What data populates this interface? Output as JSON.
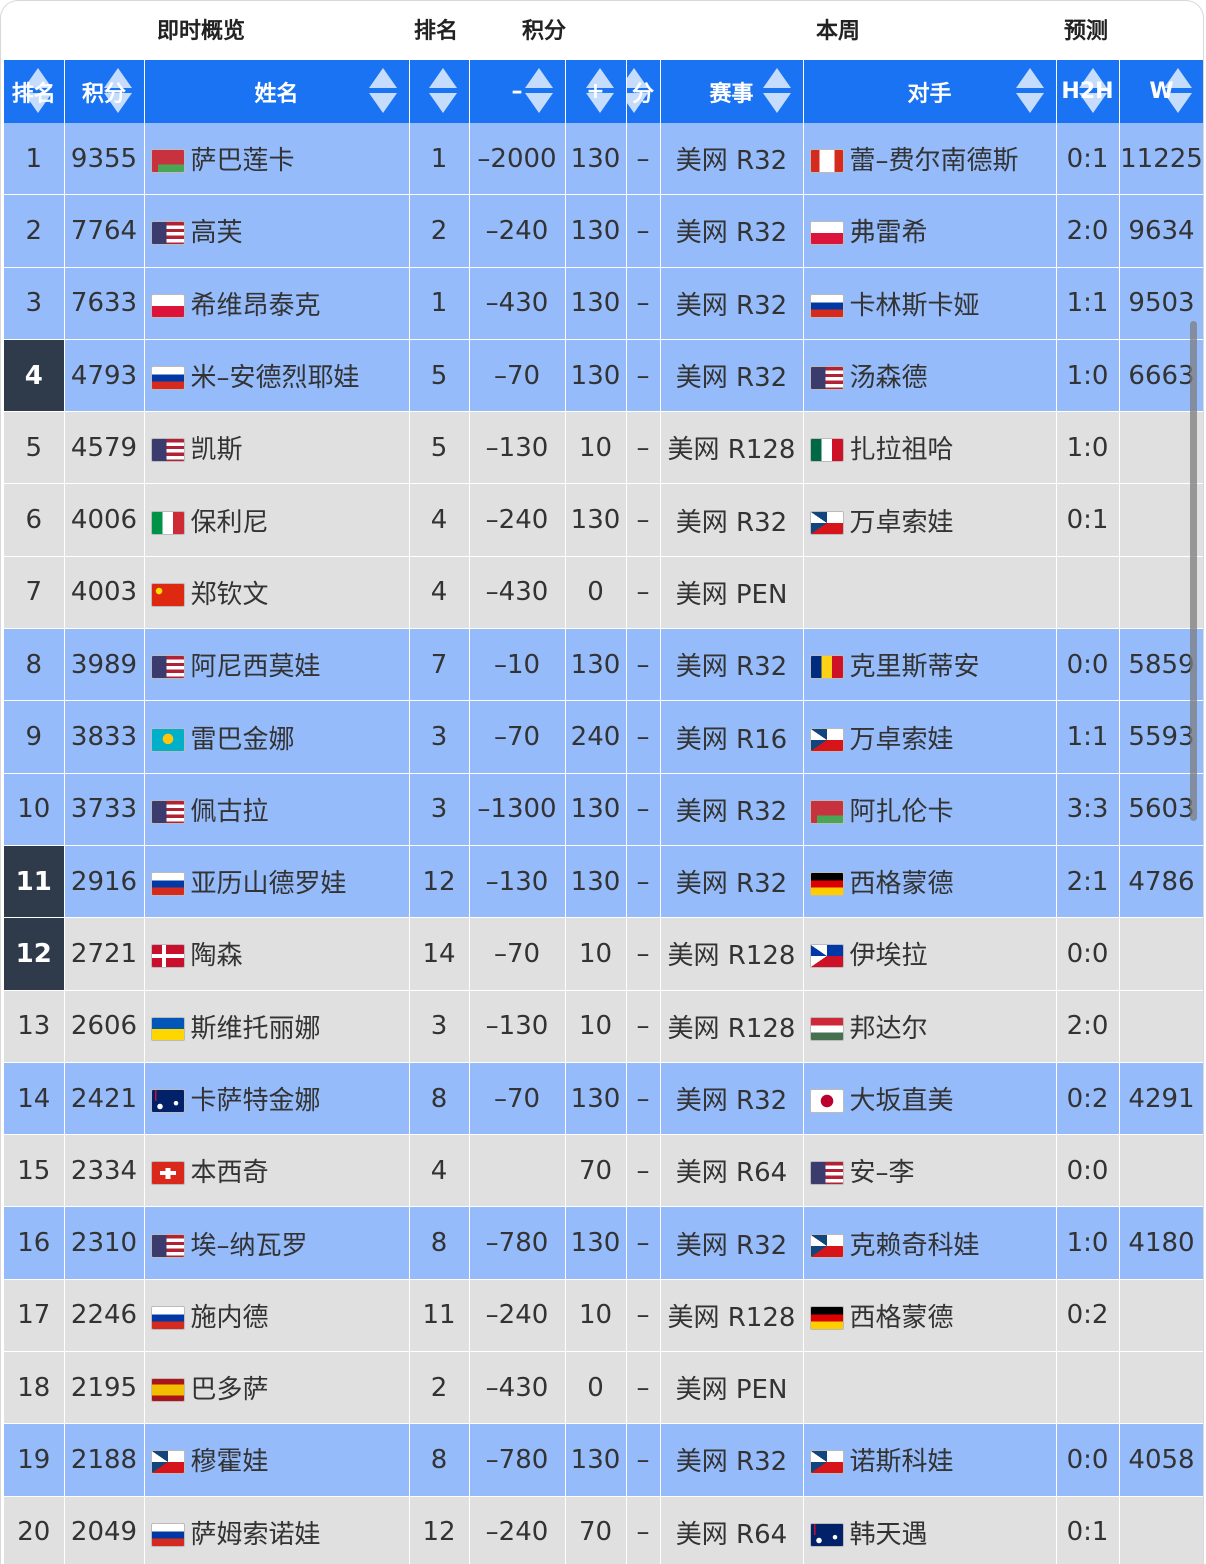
{
  "group_header": {
    "overview": "即时概览",
    "rank": "排名",
    "points": "积分",
    "week": "本周",
    "forecast": "预测"
  },
  "columns": [
    {
      "key": "rank",
      "label": "排名"
    },
    {
      "key": "points",
      "label": "积分"
    },
    {
      "key": "name",
      "label": "姓名"
    },
    {
      "key": "best_rank",
      "label": ""
    },
    {
      "key": "minus",
      "label": "–"
    },
    {
      "key": "plus",
      "label": "+"
    },
    {
      "key": "fen",
      "label": "分"
    },
    {
      "key": "event",
      "label": "赛事"
    },
    {
      "key": "opponent",
      "label": "对手"
    },
    {
      "key": "h2h",
      "label": "H2H"
    },
    {
      "key": "w",
      "label": "W"
    }
  ],
  "colors": {
    "header_blue": "#1a73f2",
    "row_highlight": "#95bbfb",
    "row_normal": "#e0e0e0",
    "rank_dark": "#2f3b4a"
  },
  "rows": [
    {
      "rank": "1",
      "points": "9355",
      "flag": "belarus",
      "name": "萨巴莲卡",
      "best_rank": "1",
      "minus": "–2000",
      "plus": "130",
      "fen": "–",
      "event": "美网 R32",
      "opp_flag": "canada",
      "opponent": "蕾–费尔南德斯",
      "h2h": "0:1",
      "w": "11225",
      "highlight": true,
      "dark_rank": false
    },
    {
      "rank": "2",
      "points": "7764",
      "flag": "usa",
      "name": "高芙",
      "best_rank": "2",
      "minus": "–240",
      "plus": "130",
      "fen": "–",
      "event": "美网 R32",
      "opp_flag": "poland",
      "opponent": "弗雷希",
      "h2h": "2:0",
      "w": "9634",
      "highlight": true,
      "dark_rank": false
    },
    {
      "rank": "3",
      "points": "7633",
      "flag": "poland",
      "name": "希维昂泰克",
      "best_rank": "1",
      "minus": "–430",
      "plus": "130",
      "fen": "–",
      "event": "美网 R32",
      "opp_flag": "russia",
      "opponent": "卡林斯卡娅",
      "h2h": "1:1",
      "w": "9503",
      "highlight": true,
      "dark_rank": false
    },
    {
      "rank": "4",
      "points": "4793",
      "flag": "russia",
      "name": "米–安德烈耶娃",
      "best_rank": "5",
      "minus": "–70",
      "plus": "130",
      "fen": "–",
      "event": "美网 R32",
      "opp_flag": "usa",
      "opponent": "汤森德",
      "h2h": "1:0",
      "w": "6663",
      "highlight": true,
      "dark_rank": true
    },
    {
      "rank": "5",
      "points": "4579",
      "flag": "usa",
      "name": "凯斯",
      "best_rank": "5",
      "minus": "–130",
      "plus": "10",
      "fen": "–",
      "event": "美网 R128",
      "opp_flag": "mexico",
      "opponent": "扎拉祖哈",
      "h2h": "1:0",
      "w": "",
      "highlight": false,
      "dark_rank": false
    },
    {
      "rank": "6",
      "points": "4006",
      "flag": "italy",
      "name": "保利尼",
      "best_rank": "4",
      "minus": "–240",
      "plus": "130",
      "fen": "–",
      "event": "美网 R32",
      "opp_flag": "czech",
      "opponent": "万卓索娃",
      "h2h": "0:1",
      "w": "",
      "highlight": false,
      "dark_rank": false
    },
    {
      "rank": "7",
      "points": "4003",
      "flag": "china",
      "name": "郑钦文",
      "best_rank": "4",
      "minus": "–430",
      "plus": "0",
      "fen": "–",
      "event": "美网 PEN",
      "opp_flag": "",
      "opponent": "",
      "h2h": "",
      "w": "",
      "highlight": false,
      "dark_rank": false
    },
    {
      "rank": "8",
      "points": "3989",
      "flag": "usa",
      "name": "阿尼西莫娃",
      "best_rank": "7",
      "minus": "–10",
      "plus": "130",
      "fen": "–",
      "event": "美网 R32",
      "opp_flag": "romania",
      "opponent": "克里斯蒂安",
      "h2h": "0:0",
      "w": "5859",
      "highlight": true,
      "dark_rank": false
    },
    {
      "rank": "9",
      "points": "3833",
      "flag": "kazakhstan",
      "name": "雷巴金娜",
      "best_rank": "3",
      "minus": "–70",
      "plus": "240",
      "fen": "–",
      "event": "美网 R16",
      "opp_flag": "czech",
      "opponent": "万卓索娃",
      "h2h": "1:1",
      "w": "5593",
      "highlight": true,
      "dark_rank": false
    },
    {
      "rank": "10",
      "points": "3733",
      "flag": "usa",
      "name": "佩古拉",
      "best_rank": "3",
      "minus": "–1300",
      "plus": "130",
      "fen": "–",
      "event": "美网 R32",
      "opp_flag": "belarus",
      "opponent": "阿扎伦卡",
      "h2h": "3:3",
      "w": "5603",
      "highlight": true,
      "dark_rank": false
    },
    {
      "rank": "11",
      "points": "2916",
      "flag": "russia",
      "name": "亚历山德罗娃",
      "best_rank": "12",
      "minus": "–130",
      "plus": "130",
      "fen": "–",
      "event": "美网 R32",
      "opp_flag": "germany",
      "opponent": "西格蒙德",
      "h2h": "2:1",
      "w": "4786",
      "highlight": true,
      "dark_rank": true
    },
    {
      "rank": "12",
      "points": "2721",
      "flag": "denmark",
      "name": "陶森",
      "best_rank": "14",
      "minus": "–70",
      "plus": "10",
      "fen": "–",
      "event": "美网 R128",
      "opp_flag": "philippines",
      "opponent": "伊埃拉",
      "h2h": "0:0",
      "w": "",
      "highlight": false,
      "dark_rank": true
    },
    {
      "rank": "13",
      "points": "2606",
      "flag": "ukraine",
      "name": "斯维托丽娜",
      "best_rank": "3",
      "minus": "–130",
      "plus": "10",
      "fen": "–",
      "event": "美网 R128",
      "opp_flag": "hungary",
      "opponent": "邦达尔",
      "h2h": "2:0",
      "w": "",
      "highlight": false,
      "dark_rank": false
    },
    {
      "rank": "14",
      "points": "2421",
      "flag": "australia",
      "name": "卡萨特金娜",
      "best_rank": "8",
      "minus": "–70",
      "plus": "130",
      "fen": "–",
      "event": "美网 R32",
      "opp_flag": "japan",
      "opponent": "大坂直美",
      "h2h": "0:2",
      "w": "4291",
      "highlight": true,
      "dark_rank": false
    },
    {
      "rank": "15",
      "points": "2334",
      "flag": "switzerland",
      "name": "本西奇",
      "best_rank": "4",
      "minus": "",
      "plus": "70",
      "fen": "–",
      "event": "美网 R64",
      "opp_flag": "usa",
      "opponent": "安–李",
      "h2h": "0:0",
      "w": "",
      "highlight": false,
      "dark_rank": false
    },
    {
      "rank": "16",
      "points": "2310",
      "flag": "usa",
      "name": "埃–纳瓦罗",
      "best_rank": "8",
      "minus": "–780",
      "plus": "130",
      "fen": "–",
      "event": "美网 R32",
      "opp_flag": "czech",
      "opponent": "克赖奇科娃",
      "h2h": "1:0",
      "w": "4180",
      "highlight": true,
      "dark_rank": false
    },
    {
      "rank": "17",
      "points": "2246",
      "flag": "russia",
      "name": "施内德",
      "best_rank": "11",
      "minus": "–240",
      "plus": "10",
      "fen": "–",
      "event": "美网 R128",
      "opp_flag": "germany",
      "opponent": "西格蒙德",
      "h2h": "0:2",
      "w": "",
      "highlight": false,
      "dark_rank": false
    },
    {
      "rank": "18",
      "points": "2195",
      "flag": "spain",
      "name": "巴多萨",
      "best_rank": "2",
      "minus": "–430",
      "plus": "0",
      "fen": "–",
      "event": "美网 PEN",
      "opp_flag": "",
      "opponent": "",
      "h2h": "",
      "w": "",
      "highlight": false,
      "dark_rank": false
    },
    {
      "rank": "19",
      "points": "2188",
      "flag": "czech",
      "name": "穆霍娃",
      "best_rank": "8",
      "minus": "–780",
      "plus": "130",
      "fen": "–",
      "event": "美网 R32",
      "opp_flag": "czech",
      "opponent": "诺斯科娃",
      "h2h": "0:0",
      "w": "4058",
      "highlight": true,
      "dark_rank": false
    },
    {
      "rank": "20",
      "points": "2049",
      "flag": "russia",
      "name": "萨姆索诺娃",
      "best_rank": "12",
      "minus": "–240",
      "plus": "70",
      "fen": "–",
      "event": "美网 R64",
      "opp_flag": "australia",
      "opponent": "韩天遇",
      "h2h": "0:1",
      "w": "",
      "highlight": false,
      "dark_rank": false
    }
  ]
}
